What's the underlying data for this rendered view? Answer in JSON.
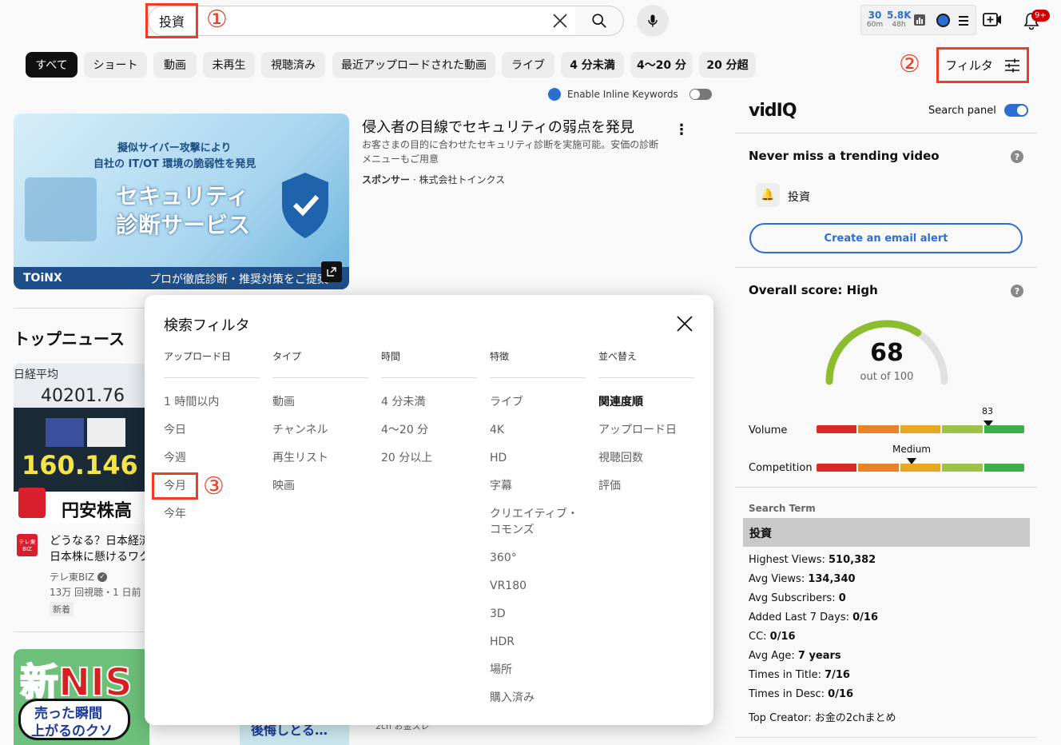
{
  "search": {
    "query": "投資"
  },
  "annotations": {
    "one": "①",
    "two": "②",
    "three": "③"
  },
  "header_stats": [
    {
      "big": "30",
      "small": "60m"
    },
    {
      "big": "5.8K",
      "small": "48h"
    }
  ],
  "notifications": {
    "badge": "9+"
  },
  "chips": [
    "すべて",
    "ショート",
    "動画",
    "未再生",
    "視聴済み",
    "最近アップロードされた動画",
    "ライブ",
    "4 分未満",
    "4〜20 分",
    "20 分超"
  ],
  "filter_button": {
    "label": "フィルタ"
  },
  "inline_keywords": {
    "label": "Enable Inline Keywords"
  },
  "ad": {
    "title": "侵入者の目線でセキュリティの弱点を発見",
    "description": "お客さまの目的に合わせたセキュリティ診断を実施可能。安価の診断メニューもご用意",
    "sponsor_label": "スポンサー",
    "sponsor_sep": " · ",
    "sponsor_name": "株式会社トインクス",
    "thumb_line1": "擬似サイバー攻撃により",
    "thumb_line2": "自社の IT/OT 環境の脆弱性を発見",
    "thumb_big1": "セキュリティ",
    "thumb_big2": "診断サービス",
    "thumb_logo": "TOiNX",
    "thumb_footer": "プロが徹底診断・推奨対策をご提案"
  },
  "top_news": {
    "heading": "トップニュース",
    "item1": {
      "thumb_label": "日経平均",
      "thumb_num1": "40201.76",
      "thumb_num2": "160.146",
      "thumb_caption": "円安株高",
      "channel_logo": "テレ東BIZ",
      "title_line1": "どうなる？日本経済",
      "title_line2": "日本株に懸けるワク",
      "channel": "テレ東BIZ",
      "meta": "13万 回視聴・1 日前",
      "badge": "新着"
    },
    "item2": {
      "thumb_text": "新NIS",
      "thumb_sub1": "売った瞬間",
      "thumb_sub2": "上がるのクソ",
      "thumb_sub3": "後悔しとる…",
      "channel_line": "2ch お金スレ"
    }
  },
  "modal": {
    "title": "検索フィルタ",
    "columns": [
      {
        "head": "アップロード日",
        "options": [
          "1 時間以内",
          "今日",
          "今週",
          "今月",
          "今年"
        ]
      },
      {
        "head": "タイプ",
        "options": [
          "動画",
          "チャンネル",
          "再生リスト",
          "映画"
        ]
      },
      {
        "head": "時間",
        "options": [
          "4 分未満",
          "4〜20 分",
          "20 分以上"
        ]
      },
      {
        "head": "特徴",
        "options": [
          "ライブ",
          "4K",
          "HD",
          "字幕",
          "クリエイティブ・コモンズ",
          "360°",
          "VR180",
          "3D",
          "HDR",
          "場所",
          "購入済み"
        ]
      },
      {
        "head": "並べ替え",
        "options": [
          "関連度順",
          "アップロード日",
          "視聴回数",
          "評価"
        ]
      }
    ]
  },
  "sidebar": {
    "brand": "vidIQ",
    "search_panel_label": "Search panel",
    "trending_title": "Never miss a trending video",
    "trending_keyword": "投資",
    "email_alert": "Create an email alert",
    "overall_title": "Overall score: High",
    "score": "68",
    "score_out_of": "out of 100",
    "score_value": 68,
    "volume_label": "Volume",
    "volume_value": "83",
    "competition_label": "Competition",
    "competition_value": "Medium",
    "search_term_label": "Search Term",
    "search_term": "投資",
    "stats": [
      {
        "label": "Highest Views: ",
        "value": "510,382"
      },
      {
        "label": "Avg Views: ",
        "value": "134,340"
      },
      {
        "label": "Avg Subscribers: ",
        "value": "0"
      },
      {
        "label": "Added Last 7 Days: ",
        "value": "0/16"
      },
      {
        "label": "CC: ",
        "value": "0/16"
      },
      {
        "label": "Avg Age: ",
        "value": "7 years"
      },
      {
        "label": "Times in Title: ",
        "value": "7/16"
      },
      {
        "label": "Times in Desc: ",
        "value": "0/16"
      },
      {
        "label": "Top Creator: ",
        "value": "お金の2chまとめ"
      }
    ]
  },
  "colors": {
    "accent": "#2c6ed1",
    "annotation": "#f23c22"
  }
}
